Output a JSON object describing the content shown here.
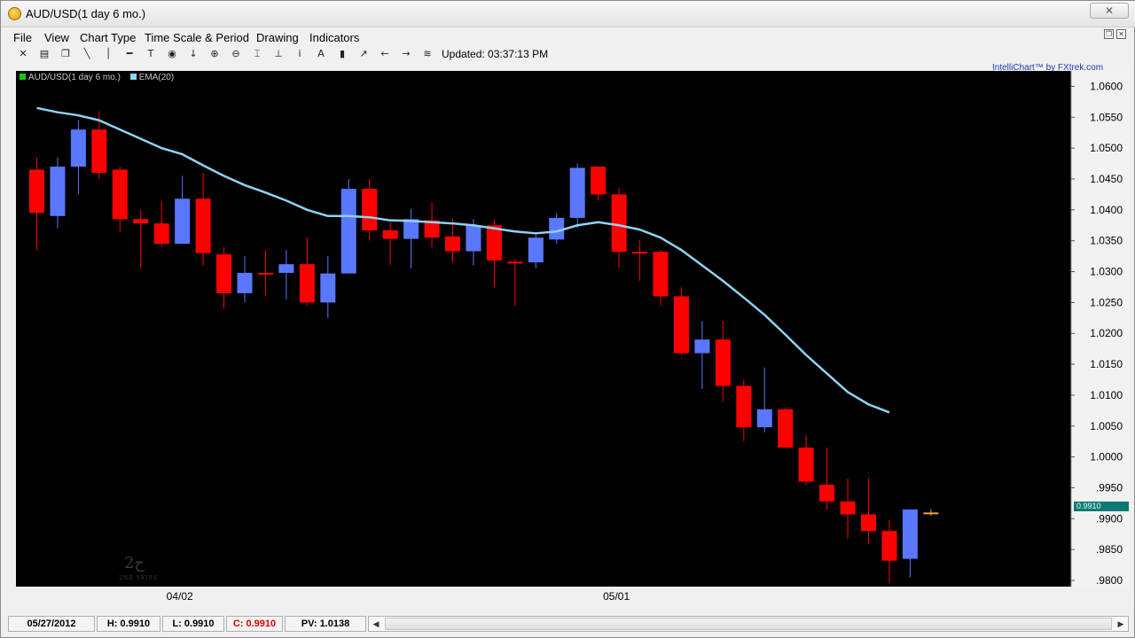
{
  "window": {
    "title": "AUD/USD(1 day  6 mo.)",
    "close_label": "✕"
  },
  "menu": [
    {
      "label": "File",
      "name": "menu-file"
    },
    {
      "label": "View",
      "name": "menu-view"
    },
    {
      "label": "Chart Type",
      "name": "menu-chart-type"
    },
    {
      "label": "Time Scale & Period",
      "name": "menu-time-scale-period"
    },
    {
      "label": "Drawing",
      "name": "menu-drawing"
    },
    {
      "label": "Indicators",
      "name": "menu-indicators"
    }
  ],
  "toolbar": {
    "icons": [
      {
        "name": "fit-chart-icon",
        "glyph": "✕"
      },
      {
        "name": "print-icon",
        "glyph": "▤"
      },
      {
        "name": "copy-icon",
        "glyph": "❐"
      },
      {
        "name": "trend-line-icon",
        "glyph": "╲"
      },
      {
        "name": "vertical-line-icon",
        "glyph": "│"
      },
      {
        "name": "horizontal-line-icon",
        "glyph": "━"
      },
      {
        "name": "text-tool-icon",
        "glyph": "T"
      },
      {
        "name": "target-icon",
        "glyph": "◉"
      },
      {
        "name": "down-arrow-icon",
        "glyph": "↓"
      },
      {
        "name": "zoom-in-icon",
        "glyph": "⊕"
      },
      {
        "name": "zoom-out-icon",
        "glyph": "⊖"
      },
      {
        "name": "fibonacci-icon",
        "glyph": "⌶"
      },
      {
        "name": "anchor-icon",
        "glyph": "⊥"
      },
      {
        "name": "info-icon",
        "glyph": "i"
      },
      {
        "name": "annotation-a-icon",
        "glyph": "A"
      },
      {
        "name": "bar-chart-icon",
        "glyph": "▮"
      },
      {
        "name": "trend-icon",
        "glyph": "↗"
      },
      {
        "name": "scroll-left-icon",
        "glyph": "←"
      },
      {
        "name": "scroll-right-icon",
        "glyph": "→"
      },
      {
        "name": "settings-lines-icon",
        "glyph": "≋"
      }
    ],
    "updated_label": "Updated: 03:37:13 PM"
  },
  "brand_link": "IntelliChart™ by FXtrek.com",
  "legend": {
    "symbol_label": "AUD/USD(1 day  6 mo.)",
    "indicator_label": "EMA(20)"
  },
  "last_price_label": "0.9910",
  "watermark": {
    "glyph": "2ح",
    "text": "2ND SKIES"
  },
  "colors": {
    "up": "#5a78ff",
    "down": "#ff0000",
    "ema": "#8fd3f4",
    "last_marker": "#f2a340",
    "price_label_bg": "#0b7a73"
  },
  "chart_data": {
    "type": "candlestick",
    "ylim": [
      0.979,
      1.0625
    ],
    "y_ticks": [
      {
        "v": 1.06,
        "label": "1.0600"
      },
      {
        "v": 1.055,
        "label": "1.0550"
      },
      {
        "v": 1.05,
        "label": "1.0500"
      },
      {
        "v": 1.045,
        "label": "1.0450"
      },
      {
        "v": 1.04,
        "label": "1.0400"
      },
      {
        "v": 1.035,
        "label": "1.0350"
      },
      {
        "v": 1.03,
        "label": "1.0300"
      },
      {
        "v": 1.025,
        "label": "1.0250"
      },
      {
        "v": 1.02,
        "label": "1.0200"
      },
      {
        "v": 1.015,
        "label": "1.0150"
      },
      {
        "v": 1.01,
        "label": "1.0100"
      },
      {
        "v": 1.005,
        "label": "1.0050"
      },
      {
        "v": 1.0,
        "label": "1.0000"
      },
      {
        "v": 0.995,
        "label": ".9950"
      },
      {
        "v": 0.99,
        "label": ".9900"
      },
      {
        "v": 0.985,
        "label": ".9850"
      },
      {
        "v": 0.98,
        "label": ".9800"
      }
    ],
    "x_labels": [
      {
        "index": 7,
        "label": "04/02"
      },
      {
        "index": 28,
        "label": "05/01"
      }
    ],
    "candles": [
      {
        "o": 1.0465,
        "h": 1.0485,
        "l": 1.0335,
        "c": 1.0395
      },
      {
        "o": 1.039,
        "h": 1.0485,
        "l": 1.037,
        "c": 1.047
      },
      {
        "o": 1.047,
        "h": 1.0545,
        "l": 1.0425,
        "c": 1.053
      },
      {
        "o": 1.053,
        "h": 1.056,
        "l": 1.045,
        "c": 1.046
      },
      {
        "o": 1.0465,
        "h": 1.047,
        "l": 1.0365,
        "c": 1.0385
      },
      {
        "o": 1.0385,
        "h": 1.04,
        "l": 1.0305,
        "c": 1.0378
      },
      {
        "o": 1.0378,
        "h": 1.0415,
        "l": 1.034,
        "c": 1.0345
      },
      {
        "o": 1.0345,
        "h": 1.0455,
        "l": 1.0345,
        "c": 1.0418
      },
      {
        "o": 1.0418,
        "h": 1.046,
        "l": 1.031,
        "c": 1.033
      },
      {
        "o": 1.0328,
        "h": 1.0338,
        "l": 1.024,
        "c": 1.0265
      },
      {
        "o": 1.0265,
        "h": 1.0325,
        "l": 1.025,
        "c": 1.0298
      },
      {
        "o": 1.0298,
        "h": 1.0335,
        "l": 1.026,
        "c": 1.0298
      },
      {
        "o": 1.0298,
        "h": 1.0335,
        "l": 1.0255,
        "c": 1.0312
      },
      {
        "o": 1.0312,
        "h": 1.0355,
        "l": 1.0245,
        "c": 1.025
      },
      {
        "o": 1.025,
        "h": 1.0325,
        "l": 1.0225,
        "c": 1.0297
      },
      {
        "o": 1.0297,
        "h": 1.045,
        "l": 1.0297,
        "c": 1.0434
      },
      {
        "o": 1.0434,
        "h": 1.045,
        "l": 1.035,
        "c": 1.0367
      },
      {
        "o": 1.0367,
        "h": 1.038,
        "l": 1.031,
        "c": 1.0353
      },
      {
        "o": 1.0353,
        "h": 1.0402,
        "l": 1.0305,
        "c": 1.0385
      },
      {
        "o": 1.0383,
        "h": 1.0412,
        "l": 1.034,
        "c": 1.0355
      },
      {
        "o": 1.0357,
        "h": 1.0385,
        "l": 1.0315,
        "c": 1.0333
      },
      {
        "o": 1.0333,
        "h": 1.0385,
        "l": 1.031,
        "c": 1.0375
      },
      {
        "o": 1.0375,
        "h": 1.0385,
        "l": 1.0275,
        "c": 1.0318
      },
      {
        "o": 1.0316,
        "h": 1.032,
        "l": 1.0245,
        "c": 1.0316
      },
      {
        "o": 1.0315,
        "h": 1.036,
        "l": 1.0305,
        "c": 1.0355
      },
      {
        "o": 1.0352,
        "h": 1.0395,
        "l": 1.0345,
        "c": 1.0387
      },
      {
        "o": 1.0387,
        "h": 1.0475,
        "l": 1.037,
        "c": 1.0468
      },
      {
        "o": 1.047,
        "h": 1.047,
        "l": 1.0415,
        "c": 1.0425
      },
      {
        "o": 1.0425,
        "h": 1.0435,
        "l": 1.0305,
        "c": 1.0332
      },
      {
        "o": 1.0332,
        "h": 1.035,
        "l": 1.0285,
        "c": 1.0332
      },
      {
        "o": 1.0332,
        "h": 1.0335,
        "l": 1.0245,
        "c": 1.026
      },
      {
        "o": 1.026,
        "h": 1.0275,
        "l": 1.0165,
        "c": 1.0168
      },
      {
        "o": 1.0168,
        "h": 1.022,
        "l": 1.011,
        "c": 1.019
      },
      {
        "o": 1.019,
        "h": 1.022,
        "l": 1.009,
        "c": 1.0115
      },
      {
        "o": 1.0115,
        "h": 1.0125,
        "l": 1.0025,
        "c": 1.0048
      },
      {
        "o": 1.0048,
        "h": 1.0145,
        "l": 1.004,
        "c": 1.0077
      },
      {
        "o": 1.0077,
        "h": 1.008,
        "l": 1.0015,
        "c": 1.0015
      },
      {
        "o": 1.0015,
        "h": 1.0035,
        "l": 0.9955,
        "c": 0.996
      },
      {
        "o": 0.9955,
        "h": 1.0015,
        "l": 0.9915,
        "c": 0.9928
      },
      {
        "o": 0.9928,
        "h": 0.9965,
        "l": 0.9868,
        "c": 0.9907
      },
      {
        "o": 0.9907,
        "h": 0.9965,
        "l": 0.986,
        "c": 0.988
      },
      {
        "o": 0.988,
        "h": 0.9898,
        "l": 0.9795,
        "c": 0.9832
      },
      {
        "o": 0.9835,
        "h": 0.9915,
        "l": 0.9805,
        "c": 0.9915
      },
      {
        "o": 0.991,
        "h": 0.9915,
        "l": 0.9905,
        "c": 0.991
      }
    ],
    "series": [
      {
        "name": "EMA(20)",
        "values": [
          1.0565,
          1.0558,
          1.0553,
          1.0545,
          1.053,
          1.0515,
          1.05,
          1.049,
          1.0472,
          1.0455,
          1.044,
          1.0428,
          1.0415,
          1.04,
          1.039,
          1.039,
          1.0388,
          1.0383,
          1.0382,
          1.038,
          1.0378,
          1.0375,
          1.037,
          1.0365,
          1.0362,
          1.0365,
          1.0375,
          1.038,
          1.0375,
          1.0368,
          1.0355,
          1.0335,
          1.031,
          1.0285,
          1.0258,
          1.023,
          1.0198,
          1.0165,
          1.0135,
          1.0105,
          1.0085,
          1.0072
        ]
      }
    ]
  },
  "status": {
    "date": "05/27/2012",
    "high": "H: 0.9910",
    "low": "L: 0.9910",
    "close": "C: 0.9910",
    "pv": "PV: 1.0138"
  }
}
